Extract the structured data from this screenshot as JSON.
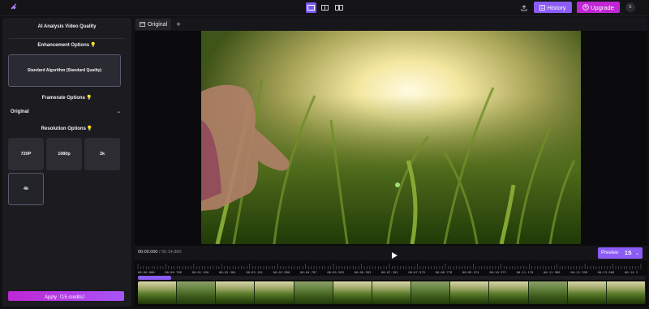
{
  "app": {
    "logo": "𝒽"
  },
  "topbar": {
    "history_label": "History",
    "upgrade_label": "Upgrade",
    "avatar": "E"
  },
  "sidebar": {
    "title": "AI Analysis Video Quality",
    "enhancement_heading": "Enhancement Options",
    "algorithm_label": "Standard Algorithm (Standard Quality)",
    "framerate_heading": "Framerate Options",
    "framerate_value": "Original",
    "resolution_heading": "Resolution Options",
    "resolutions": [
      "720P",
      "1080p",
      "2k",
      "4k"
    ],
    "apply_label": "Apply（15 credits）"
  },
  "tabs": {
    "active_label": "Original",
    "add_label": "+"
  },
  "player": {
    "current_time": "00:00.000",
    "duration": "00:14.880",
    "preview_label": "Preview",
    "preview_seconds": "1S",
    "progress_fraction": 0.066
  },
  "timeline": {
    "ticks": [
      "00:00.000",
      "00:00.788",
      "00:01.590",
      "00:02.384",
      "00:03.181",
      "00:03.980",
      "00:04.787",
      "00:05.583",
      "00:06.383",
      "00:07.181",
      "00:07.979",
      "00:08.778",
      "00:09.574",
      "00:10.372",
      "00:11.170",
      "00:11.966",
      "00:12.768",
      "00:13.568",
      "00:14.3"
    ]
  },
  "colors": {
    "accent": "#8b5cf6",
    "upgrade": "#c026d3"
  }
}
